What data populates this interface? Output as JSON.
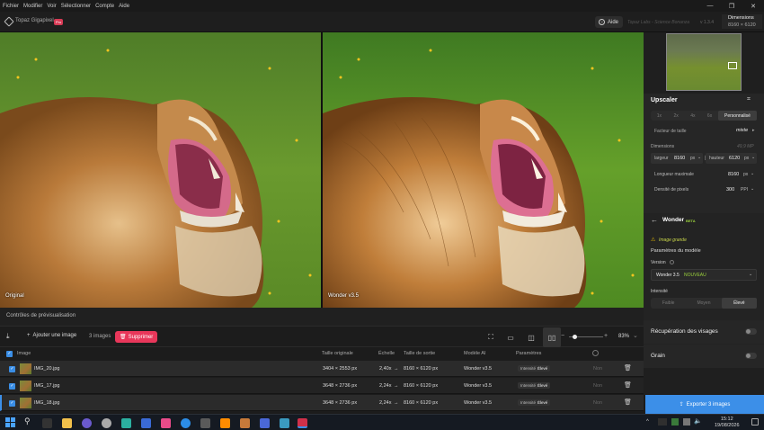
{
  "menu": [
    "Fichier",
    "Modifier",
    "Voir",
    "Sélectionner",
    "Compte",
    "Aide"
  ],
  "app": {
    "title": "Topaz Gigapixel",
    "badge": "Pro",
    "help": "Aide",
    "project": "Topaz Labs - Science Bonanza",
    "version": "v 1.3.4",
    "dims_label": "Dimensions",
    "dims_value": "8160 × 6120"
  },
  "preview": {
    "left_label": "Original",
    "right_label": "Wonder v3.5"
  },
  "controls": {
    "title": "Contrôles de prévisualisation",
    "add": "Ajouter une image",
    "count": "3 images",
    "delete": "Supprimer",
    "zoom": "83%"
  },
  "table": {
    "headers": {
      "image": "Image",
      "orig": "Taille originale",
      "scale": "Échelle",
      "out": "Taille de sortie",
      "model": "Modèle AI",
      "params": "Paramètres"
    },
    "rows": [
      {
        "name": "IMG_20.jpg",
        "orig": "3404 × 2553 px",
        "scale": "2,40x",
        "out": "8160 × 6120 px",
        "model": "Wonder v3.5",
        "p_label": "Intensité",
        "p_val": "Élevé",
        "p2": "Non"
      },
      {
        "name": "IMG_17.jpg",
        "orig": "3648 × 2736 px",
        "scale": "2,24x",
        "out": "8160 × 6120 px",
        "model": "Wonder v3.5",
        "p_label": "Intensité",
        "p_val": "Élevé",
        "p2": "Non"
      },
      {
        "name": "IMG_18.jpg",
        "orig": "3648 × 2736 px",
        "scale": "2,24x",
        "out": "8160 × 6120 px",
        "model": "Wonder v3.5",
        "p_label": "Intensité",
        "p_val": "Élevé",
        "p2": "Non"
      }
    ]
  },
  "panel": {
    "upscaler": "Upscaler",
    "scales": [
      "1x",
      "2x",
      "4x",
      "6x",
      "Personnalisé"
    ],
    "factor_label": "Facteur de taille",
    "factor_value": "mixte",
    "dims_label": "Dimensions",
    "dims_mp": "49,9 MP",
    "width_label": "largeur",
    "width": "8160",
    "width_unit": "px",
    "height_label": "hauteur",
    "height": "6120",
    "height_unit": "px",
    "maxlen_label": "Longueur maximale",
    "maxlen": "8160",
    "maxlen_unit": "px",
    "density_label": "Densité de pixels",
    "density": "300",
    "density_unit": "PPI",
    "model": "Wonder",
    "model_badge": "BETA",
    "warning": "Image grande",
    "params_label": "Paramètres du modèle",
    "version_label": "Version",
    "version_value": "Wonder 3.5",
    "version_new": "NOUVEAU",
    "intensity_label": "Intensité",
    "intensity": [
      "Faible",
      "Moyen",
      "Élevé"
    ],
    "faces": "Récupération des visages",
    "grain": "Grain",
    "export": "Exporter 3 images"
  },
  "taskbar": {
    "time": "15:12",
    "date": "19/08/2026"
  },
  "colors": {
    "accent": "#3c8fe8",
    "delete": "#e8375a",
    "new": "#9bd23c"
  }
}
